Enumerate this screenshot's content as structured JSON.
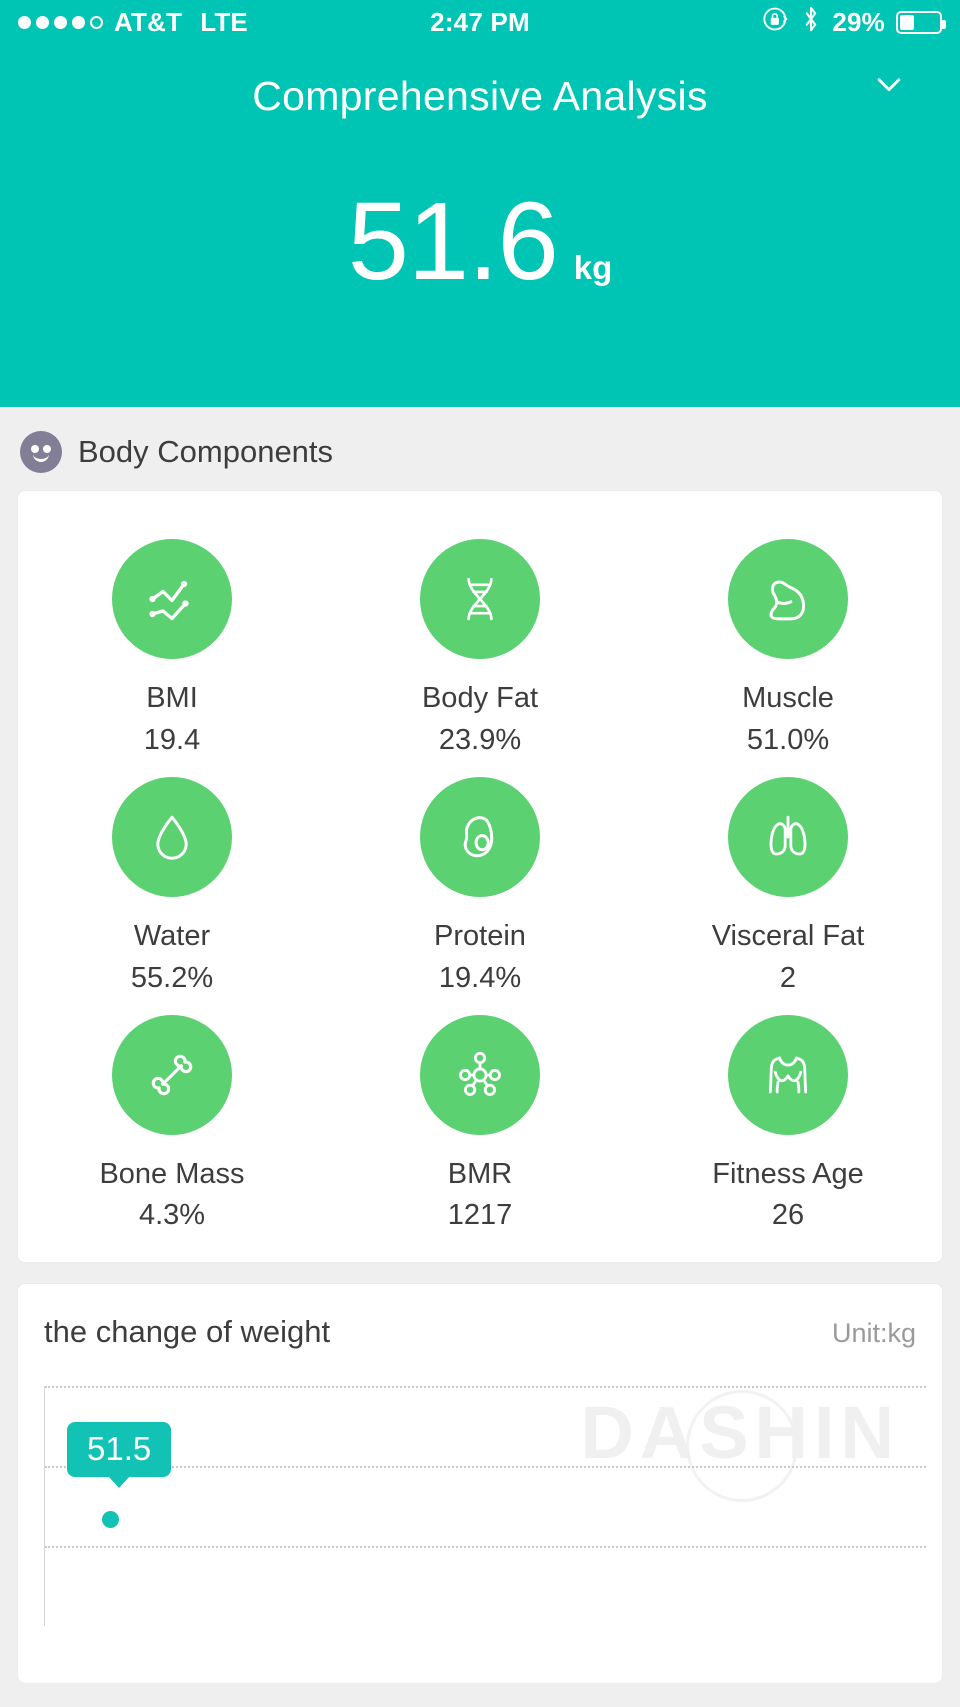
{
  "status_bar": {
    "signal_dots_filled": 4,
    "signal_dots_total": 5,
    "carrier": "AT&T",
    "network": "LTE",
    "time": "2:47 PM",
    "rotation_lock_icon": "rotation-lock-icon",
    "bluetooth_icon": "bluetooth-icon",
    "battery_percent": "29%",
    "battery_level": 29
  },
  "header": {
    "title": "Comprehensive Analysis",
    "expand_icon": "chevron-down-icon",
    "weight_value": "51.6",
    "weight_unit": "kg",
    "background_color": "#00c5b4"
  },
  "section": {
    "icon": "smiley-face-icon",
    "title": "Body Components"
  },
  "metrics": [
    {
      "icon": "line-chart-icon",
      "label": "BMI",
      "value": "19.4"
    },
    {
      "icon": "dna-icon",
      "label": "Body Fat",
      "value": "23.9%"
    },
    {
      "icon": "muscle-arm-icon",
      "label": "Muscle",
      "value": "51.0%"
    },
    {
      "icon": "water-drop-icon",
      "label": "Water",
      "value": "55.2%"
    },
    {
      "icon": "avocado-icon",
      "label": "Protein",
      "value": "19.4%"
    },
    {
      "icon": "lungs-icon",
      "label": "Visceral Fat",
      "value": "2"
    },
    {
      "icon": "bone-icon",
      "label": "Bone Mass",
      "value": "4.3%"
    },
    {
      "icon": "molecule-icon",
      "label": "BMR",
      "value": "1217"
    },
    {
      "icon": "torso-icon",
      "label": "Fitness Age",
      "value": "26"
    }
  ],
  "metric_icon_color": "#5bd171",
  "chart": {
    "title": "the change of weight",
    "unit_label": "Unit:kg",
    "watermark": "DASHIN",
    "point_label": "51.5",
    "accent_color": "#12c2b4"
  },
  "chart_data": {
    "type": "line",
    "title": "the change of weight",
    "xlabel": "",
    "ylabel": "",
    "unit": "kg",
    "grid": true,
    "legend": "none",
    "annotations": [
      "51.5"
    ],
    "x": [
      0
    ],
    "values": [
      51.5
    ],
    "data_labels": [
      "51.5"
    ]
  }
}
